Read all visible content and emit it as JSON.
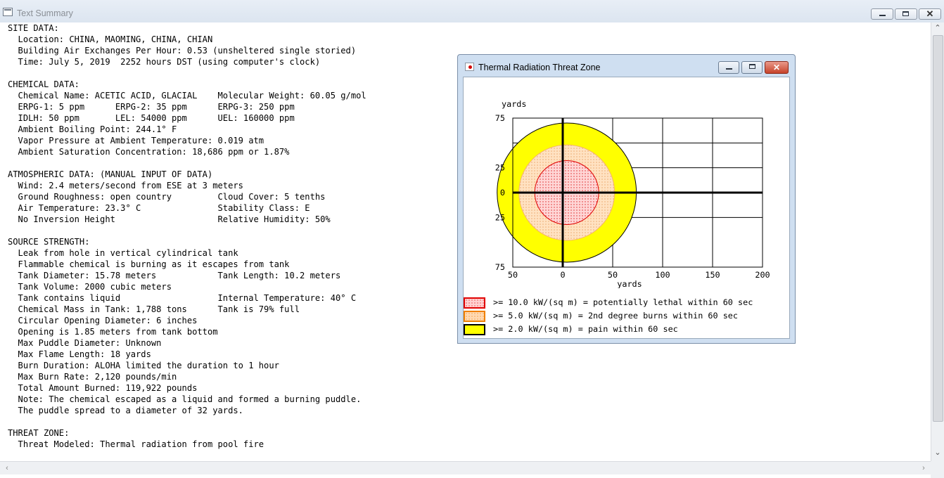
{
  "main_window": {
    "title": "Text Summary",
    "buttons": [
      "minimize",
      "maximize",
      "close"
    ]
  },
  "summary_lines": [
    "SITE DATA:",
    "  Location: CHINA, MAOMING, CHINA, CHIAN",
    "  Building Air Exchanges Per Hour: 0.53 (unsheltered single storied)",
    "  Time: July 5, 2019  2252 hours DST (using computer's clock)",
    "",
    "CHEMICAL DATA:",
    "  Chemical Name: ACETIC ACID, GLACIAL    Molecular Weight: 60.05 g/mol",
    "  ERPG-1: 5 ppm      ERPG-2: 35 ppm      ERPG-3: 250 ppm",
    "  IDLH: 50 ppm       LEL: 54000 ppm      UEL: 160000 ppm",
    "  Ambient Boiling Point: 244.1° F",
    "  Vapor Pressure at Ambient Temperature: 0.019 atm",
    "  Ambient Saturation Concentration: 18,686 ppm or 1.87%",
    "",
    "ATMOSPHERIC DATA: (MANUAL INPUT OF DATA)",
    "  Wind: 2.4 meters/second from ESE at 3 meters",
    "  Ground Roughness: open country         Cloud Cover: 5 tenths",
    "  Air Temperature: 23.3° C               Stability Class: E",
    "  No Inversion Height                    Relative Humidity: 50%",
    "",
    "SOURCE STRENGTH:",
    "  Leak from hole in vertical cylindrical tank",
    "  Flammable chemical is burning as it escapes from tank",
    "  Tank Diameter: 15.78 meters            Tank Length: 10.2 meters",
    "  Tank Volume: 2000 cubic meters",
    "  Tank contains liquid                   Internal Temperature: 40° C",
    "  Chemical Mass in Tank: 1,788 tons      Tank is 79% full",
    "  Circular Opening Diameter: 6 inches",
    "  Opening is 1.85 meters from tank bottom",
    "  Max Puddle Diameter: Unknown",
    "  Max Flame Length: 18 yards",
    "  Burn Duration: ALOHA limited the duration to 1 hour",
    "  Max Burn Rate: 2,120 pounds/min",
    "  Total Amount Burned: 119,922 pounds",
    "  Note: The chemical escaped as a liquid and formed a burning puddle.",
    "  The puddle spread to a diameter of 32 yards.",
    "",
    "THREAT ZONE:",
    "  Threat Modeled: Thermal radiation from pool fire"
  ],
  "threat_window": {
    "title": "Thermal Radiation Threat Zone",
    "y_unit": "yards",
    "x_unit": "yards",
    "y_ticks": [
      "75",
      "25",
      "0",
      "25",
      "75"
    ],
    "x_ticks": [
      "50",
      "0",
      "50",
      "100",
      "150",
      "200"
    ],
    "legend": [
      {
        "text": ">= 10.0 kW/(sq m) = potentially lethal within 60 sec",
        "border": "#e00000",
        "fill": "#ffd0d0",
        "pattern": "dots"
      },
      {
        "text": ">= 5.0 kW/(sq m) = 2nd degree burns within 60 sec",
        "border": "#f08000",
        "fill": "#ffd9b3",
        "pattern": "dots"
      },
      {
        "text": ">= 2.0 kW/(sq m) = pain within 60 sec",
        "border": "#000000",
        "fill": "#ffff00",
        "pattern": "solid"
      }
    ],
    "zones_yards": {
      "red_radius": 32,
      "orange_radius": 52,
      "yellow_radius": 77
    },
    "colors": {
      "red_outline": "#e00000",
      "orange_fill": "#ffcc99",
      "yellow_fill": "#ffff00"
    }
  }
}
